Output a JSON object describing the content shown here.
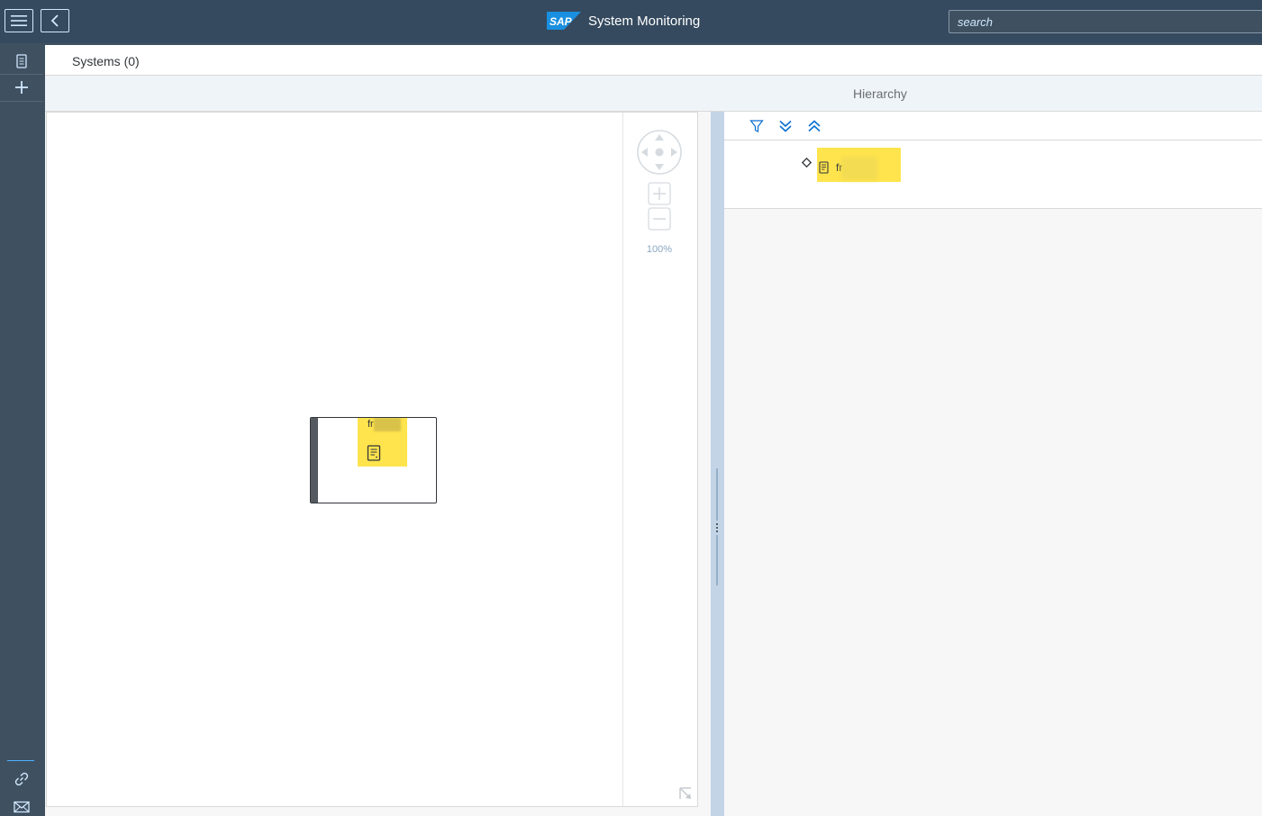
{
  "shell": {
    "title": "System Monitoring",
    "logo": "SAP",
    "search_placeholder": "search",
    "menu_icon": "hamburger-icon",
    "back_icon": "chevron-left-icon"
  },
  "rail": {
    "items": [
      "document-icon",
      "add-icon"
    ],
    "bottom_items": [
      "link-icon",
      "mail-icon"
    ]
  },
  "subheader": {
    "title": "Systems (0)"
  },
  "hierarchy": {
    "title": "Hierarchy",
    "toolbar_icons": [
      "filter-icon",
      "expand-all-icon",
      "collapse-all-icon"
    ],
    "tree": [
      {
        "label": "fr",
        "icon": "document-icon",
        "expander": "diamond-icon"
      }
    ]
  },
  "graph": {
    "zoom_level": "100%",
    "node": {
      "label": "fr",
      "icon": "document-icon"
    }
  },
  "colors": {
    "shell_bg": "#354a5f",
    "rail_bg": "#3f5161",
    "highlight": "#ffe44d",
    "splitter": "#c2d4e6"
  }
}
